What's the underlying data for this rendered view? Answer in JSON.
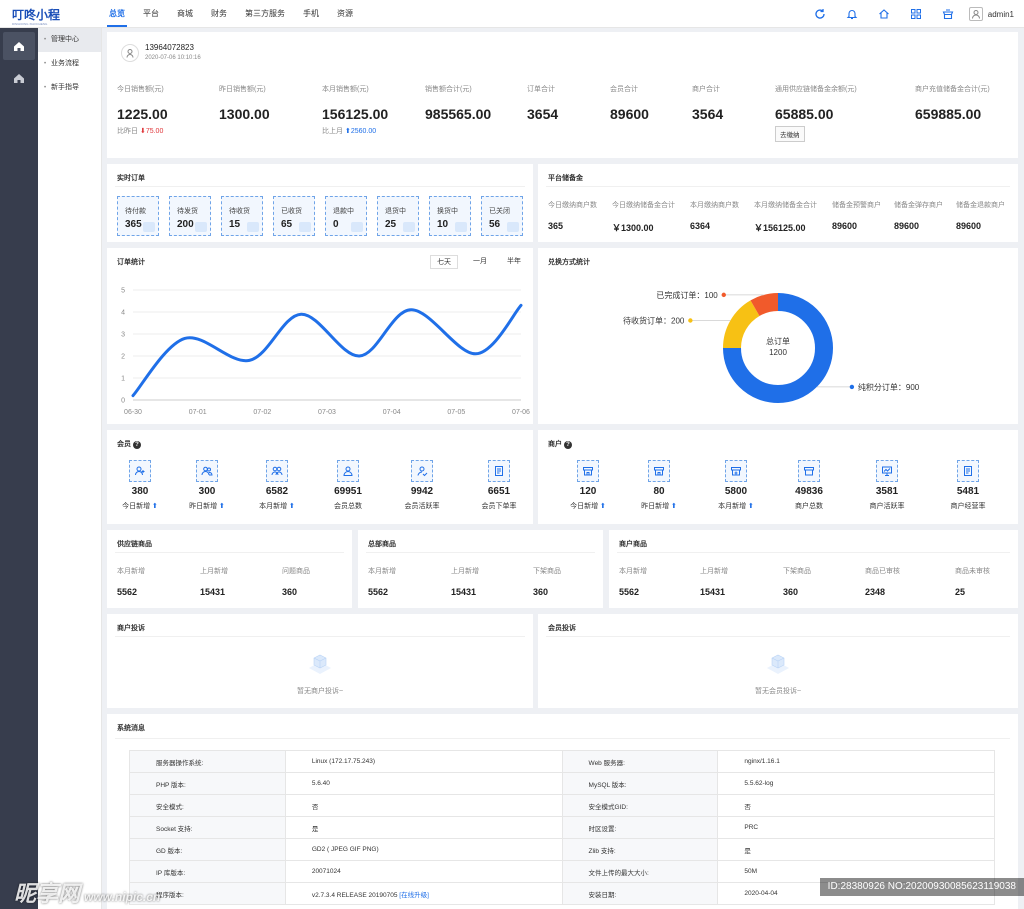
{
  "header": {
    "logo": "叮咚小程",
    "logo_sub": "DINGDONG XIAOCHENG",
    "nav": [
      "总览",
      "平台",
      "商城",
      "财务",
      "第三方服务",
      "手机",
      "资源"
    ],
    "username": "admin1",
    "icons": [
      "refresh-icon",
      "bell-icon",
      "home-icon",
      "grid-icon",
      "store-icon"
    ]
  },
  "sidebar": {
    "icons": [
      "home-icon",
      "home-icon"
    ],
    "sub_items": [
      "管理中心",
      "业务流程",
      "新手指导"
    ]
  },
  "account": {
    "phone": "13964072823",
    "time": "2020-07-06 10:10:16"
  },
  "sales": {
    "stats": [
      {
        "label": "今日销售额(元)",
        "value": "1225.00",
        "compare_label": "比昨日",
        "compare_value": "75.00",
        "direction": "down"
      },
      {
        "label": "昨日销售额(元)",
        "value": "1300.00"
      },
      {
        "label": "本月销售额(元)",
        "value": "156125.00",
        "compare_label": "比上月",
        "compare_value": "2560.00",
        "direction": "up"
      },
      {
        "label": "销售额合计(元)",
        "value": "985565.00"
      },
      {
        "label": "订单合计",
        "value": "3654"
      },
      {
        "label": "会员合计",
        "value": "89600"
      },
      {
        "label": "商户合计",
        "value": "3564"
      },
      {
        "label": "通用供应链储备金余额(元)",
        "value": "65885.00",
        "button": "去缴纳"
      },
      {
        "label": "商户充值储备金合计(元)",
        "value": "659885.00"
      }
    ]
  },
  "realtime_orders": {
    "title": "实时订单",
    "tiles": [
      {
        "label": "待付款",
        "value": "365"
      },
      {
        "label": "待发货",
        "value": "200"
      },
      {
        "label": "待收货",
        "value": "15"
      },
      {
        "label": "已收货",
        "value": "65"
      },
      {
        "label": "退款中",
        "value": "0"
      },
      {
        "label": "退货中",
        "value": "25"
      },
      {
        "label": "换货中",
        "value": "10"
      },
      {
        "label": "已关闭",
        "value": "56"
      }
    ]
  },
  "platform_reserve": {
    "title": "平台储备金",
    "cells": [
      {
        "label": "今日缴纳商户数",
        "value": "365"
      },
      {
        "label": "今日缴纳储备金合计",
        "value": "￥1300.00"
      },
      {
        "label": "本月缴纳商户数",
        "value": "6364"
      },
      {
        "label": "本月缴纳储备金合计",
        "value": "￥156125.00"
      },
      {
        "label": "储备金预警商户",
        "value": "89600"
      },
      {
        "label": "储备金弹存商户",
        "value": "89600"
      },
      {
        "label": "储备金退款商户",
        "value": "89600"
      }
    ]
  },
  "order_stats": {
    "title": "订单统计",
    "tabs": [
      "七天",
      "一月",
      "半年"
    ],
    "active_tab": 0
  },
  "chart_data": [
    {
      "type": "line",
      "title": "订单统计",
      "x": [
        "06-30",
        "07-01",
        "07-02",
        "07-03",
        "07-04",
        "07-05",
        "07-06"
      ],
      "series": [
        {
          "values": [
            0.2,
            2.8,
            1.8,
            3.9,
            2.0,
            4.1,
            2.1,
            4.3
          ]
        }
      ],
      "x_points": [
        0,
        0.8,
        1.8,
        2.6,
        3.5,
        4.3,
        5.3,
        6.0
      ],
      "ylim": [
        0,
        5
      ],
      "yticks": [
        0,
        1,
        2,
        3,
        4,
        5
      ],
      "grid": true,
      "color": "#1f6fe8"
    },
    {
      "type": "pie",
      "title": "兑换方式统计",
      "center_label": "总订单",
      "center_value": "1200",
      "slices": [
        {
          "name": "纯积分订单",
          "value": 900,
          "color": "#1f6fe8"
        },
        {
          "name": "待收货订单",
          "value": 200,
          "color": "#f7c114"
        },
        {
          "name": "已完成订单",
          "value": 100,
          "color": "#f15a2b"
        }
      ]
    }
  ],
  "exchange": {
    "title": "兑换方式统计",
    "center_label": "总订单",
    "center_value": "1200"
  },
  "members": {
    "title": "会员",
    "items": [
      {
        "value": "380",
        "label": "今日新增",
        "up": true,
        "icon": "user-add-icon"
      },
      {
        "value": "300",
        "label": "昨日新增",
        "up": true,
        "icon": "users-icon"
      },
      {
        "value": "6582",
        "label": "本月新增",
        "up": true,
        "icon": "user-group-icon"
      },
      {
        "value": "69951",
        "label": "会员总数",
        "up": false,
        "icon": "user-icon"
      },
      {
        "value": "9942",
        "label": "会员活跃率",
        "up": false,
        "icon": "user-active-icon"
      },
      {
        "value": "6651",
        "label": "会员下单率",
        "up": false,
        "icon": "order-icon"
      }
    ]
  },
  "merchants": {
    "title": "商户",
    "items": [
      {
        "value": "120",
        "label": "今日新增",
        "up": true,
        "icon": "shop-icon"
      },
      {
        "value": "80",
        "label": "昨日新增",
        "up": true,
        "icon": "shop-icon"
      },
      {
        "value": "5800",
        "label": "本月新增",
        "up": true,
        "icon": "shop-add-icon"
      },
      {
        "value": "49836",
        "label": "商户总数",
        "up": false,
        "icon": "shop-icon"
      },
      {
        "value": "3581",
        "label": "商户活跃率",
        "up": false,
        "icon": "monitor-icon"
      },
      {
        "value": "5481",
        "label": "商户经营率",
        "up": false,
        "icon": "doc-icon"
      }
    ]
  },
  "supply_goods": {
    "title": "供应链商品",
    "cells": [
      {
        "label": "本月新增",
        "value": "5562"
      },
      {
        "label": "上月新增",
        "value": "15431"
      },
      {
        "label": "问题商品",
        "value": "360"
      }
    ]
  },
  "hq_goods": {
    "title": "总部商品",
    "cells": [
      {
        "label": "本月新增",
        "value": "5562"
      },
      {
        "label": "上月新增",
        "value": "15431"
      },
      {
        "label": "下架商品",
        "value": "360"
      }
    ]
  },
  "merchant_goods": {
    "title": "商户商品",
    "cells": [
      {
        "label": "本月新增",
        "value": "5562"
      },
      {
        "label": "上月新增",
        "value": "15431"
      },
      {
        "label": "下架商品",
        "value": "360"
      },
      {
        "label": "商品已审核",
        "value": "2348"
      },
      {
        "label": "商品未审核",
        "value": "25"
      }
    ]
  },
  "complaints": {
    "merchant_title": "商户投诉",
    "merchant_empty": "暂无商户投诉~",
    "member_title": "会员投诉",
    "member_empty": "暂无会员投诉~"
  },
  "system": {
    "title": "系统消息",
    "rows": [
      [
        "服务器操作系统:",
        "Linux (172.17.75.243)",
        "Web 服务器:",
        "nginx/1.16.1"
      ],
      [
        "PHP 版本:",
        "5.6.40",
        "MySQL 版本:",
        "5.5.62-log"
      ],
      [
        "安全模式:",
        "否",
        "安全模式GID:",
        "否"
      ],
      [
        "Socket 支持:",
        "是",
        "时区设置:",
        "PRC"
      ],
      [
        "GD 版本:",
        "GD2 ( JPEG GIF PNG)",
        "Zlib 支持:",
        "是"
      ],
      [
        "IP 库版本:",
        "20071024",
        "文件上传的最大大小:",
        "50M"
      ],
      [
        "程序版本:",
        "v2.7.3.4 RELEASE 20190705",
        "安装日期:",
        "2020-04-04"
      ]
    ],
    "upgrade_link": "[在线升级]"
  },
  "watermark": {
    "left": "昵享网",
    "left_sub": "www.nipic.cn",
    "right": "ID:28380926 NO:20200930085623119038"
  },
  "colors": {
    "accent": "#1f6fe8",
    "down": "#e0373b",
    "sidebar": "#373d4d"
  }
}
